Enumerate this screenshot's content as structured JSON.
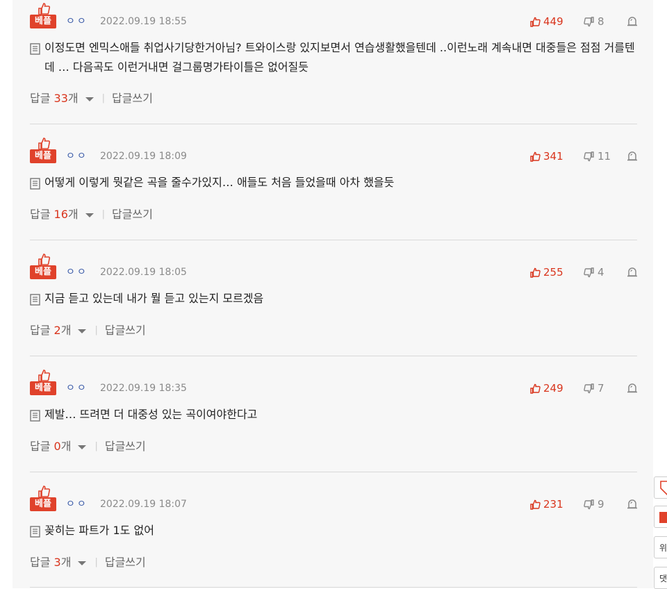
{
  "comments": [
    {
      "badge": "베플",
      "user": "ㅇㅇ",
      "date": "2022.09.19 18:55",
      "likes": "449",
      "dislikes": "8",
      "text": "이정도면 엔믹스애들 취업사기당한거아님? 트와이스랑 있지보면서 연습생활했을텐데 ..이런노래 계속내면 대중들은 점점 거를텐데 … 다음곡도 이런거내면 걸그룹명가타이틀은 없어질듯",
      "reply_label": "답글",
      "reply_count": "33",
      "reply_unit": "개",
      "write_reply": "답글쓰기"
    },
    {
      "badge": "베플",
      "user": "ㅇㅇ",
      "date": "2022.09.19 18:09",
      "likes": "341",
      "dislikes": "11",
      "text": "어떻게 이렇게 뭣같은 곡을 줄수가있지… 애들도 처음 들었을때 아차 했을듯",
      "reply_label": "답글",
      "reply_count": "16",
      "reply_unit": "개",
      "write_reply": "답글쓰기"
    },
    {
      "badge": "베플",
      "user": "ㅇㅇ",
      "date": "2022.09.19 18:05",
      "likes": "255",
      "dislikes": "4",
      "text": "지금 듣고 있는데 내가 뭘 듣고 있는지 모르겠음",
      "reply_label": "답글",
      "reply_count": "2",
      "reply_unit": "개",
      "write_reply": "답글쓰기"
    },
    {
      "badge": "베플",
      "user": "ㅇㅇ",
      "date": "2022.09.19 18:35",
      "likes": "249",
      "dislikes": "7",
      "text": "제발… 뜨려면 더 대중성 있는 곡이여야한다고",
      "reply_label": "답글",
      "reply_count": "0",
      "reply_unit": "개",
      "write_reply": "답글쓰기"
    },
    {
      "badge": "베플",
      "user": "ㅇㅇ",
      "date": "2022.09.19 18:07",
      "likes": "231",
      "dislikes": "9",
      "text": "꽂히는 파트가 1도 없어",
      "reply_label": "답글",
      "reply_count": "3",
      "reply_unit": "개",
      "write_reply": "답글쓰기"
    }
  ],
  "side": {
    "top_label": "위",
    "comment_label": "댓"
  },
  "colors": {
    "accent": "#e0422b",
    "like": "#d9351d",
    "user": "#3b5ba8",
    "date": "#8a8a8a"
  }
}
